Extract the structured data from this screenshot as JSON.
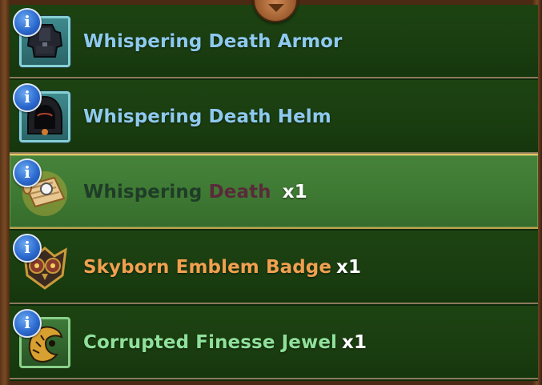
{
  "items": [
    {
      "name": "Whispering Death Armor",
      "qty": "",
      "name_color": "#8ec9ee",
      "icon": "armor-icon",
      "selected": false
    },
    {
      "name": "Whispering Death Helm",
      "qty": "",
      "name_color": "#8ec9ee",
      "icon": "helm-icon",
      "selected": false
    },
    {
      "name_part1": "Whispering",
      "name_part2": "Death",
      "qty": "x1",
      "icon": "scroll-icon",
      "selected": true
    },
    {
      "name": "Skyborn Emblem Badge",
      "qty": "x1",
      "name_color": "#f0a050",
      "icon": "owl-badge-icon",
      "selected": false
    },
    {
      "name": "Corrupted Finesse Jewel",
      "qty": "x1",
      "name_color": "#8fe09a",
      "icon": "jewel-icon",
      "selected": false
    }
  ],
  "info_label": "i",
  "colors": {
    "row_bg": "#1d4312",
    "row_selected_bg": "#46833a",
    "selected_border": "#e8c860",
    "frame_wood": "#5a3418"
  }
}
